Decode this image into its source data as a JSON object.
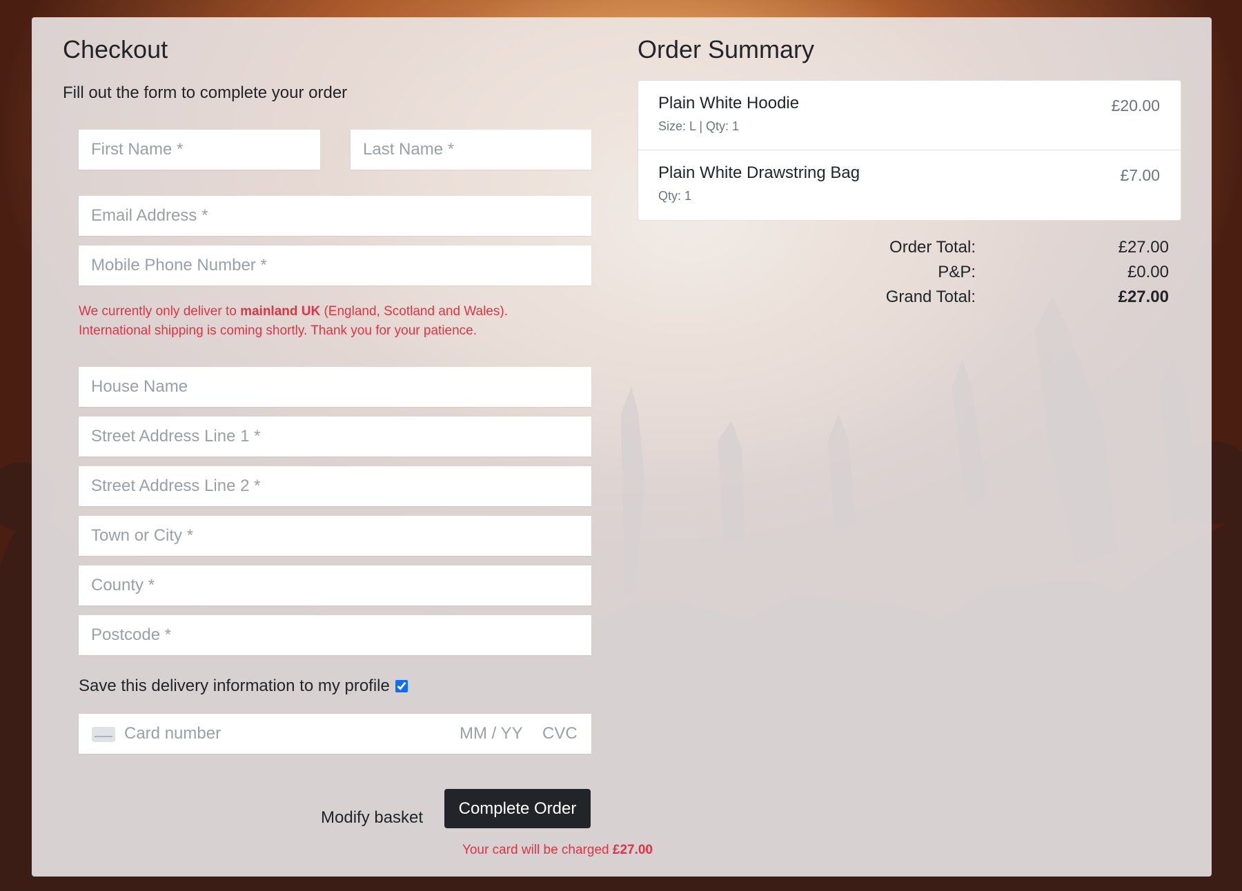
{
  "checkout": {
    "title": "Checkout",
    "subtitle": "Fill out the form to complete your order",
    "fields": {
      "first_name": "First Name *",
      "last_name": "Last Name *",
      "email": "Email Address *",
      "phone": "Mobile Phone Number *",
      "house_name": "House Name",
      "street1": "Street Address Line 1 *",
      "street2": "Street Address Line 2 *",
      "town": "Town or City *",
      "county": "County *",
      "postcode": "Postcode *"
    },
    "notice": {
      "part1": "We currently only deliver to ",
      "bold": "mainland UK",
      "part2": " (England, Scotland and Wales).",
      "line2": "International shipping is coming shortly. Thank you for your patience."
    },
    "save_label": "Save this delivery information to my profile",
    "save_checked": true,
    "card": {
      "number_placeholder": "Card number",
      "expiry_placeholder": "MM / YY",
      "cvc_placeholder": "CVC",
      "icon": "credit-card-icon"
    },
    "modify_label": "Modify basket",
    "complete_label": "Complete Order",
    "charge_prefix": "Your card will be charged ",
    "charge_amount": "£27.00",
    "alert_color": "#dc3545",
    "button_color": "#212529"
  },
  "summary": {
    "title": "Order Summary",
    "items": [
      {
        "name": "Plain White Hoodie",
        "meta": "Size: L | Qty: 1",
        "price": "£20.00"
      },
      {
        "name": "Plain White Drawstring Bag",
        "meta": "Qty: 1",
        "price": "£7.00"
      }
    ],
    "order_total_label": "Order Total:",
    "order_total": "£27.00",
    "pp_label": "P&P:",
    "pp": "£0.00",
    "grand_total_label": "Grand Total:",
    "grand_total": "£27.00"
  }
}
